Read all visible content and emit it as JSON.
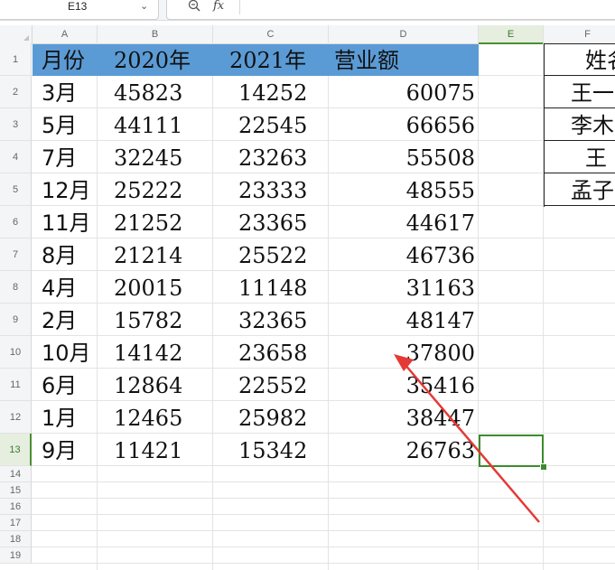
{
  "toolbar": {
    "name_box": "E13",
    "fx_label": "fx",
    "zoom_icon": "zoom-icon",
    "dropdown_icon": "chevron-down-icon"
  },
  "columns": [
    "A",
    "B",
    "C",
    "D",
    "E",
    "F"
  ],
  "active_column": "E",
  "active_row": "13",
  "rows": [
    "1",
    "2",
    "3",
    "4",
    "5",
    "6",
    "7",
    "8",
    "9",
    "10",
    "11",
    "12",
    "13",
    "14",
    "15",
    "16",
    "17",
    "18",
    "19"
  ],
  "header": {
    "a": "月份",
    "b": "2020年",
    "c": "2021年",
    "d": "营业额"
  },
  "data_rows": [
    {
      "a": "3月",
      "b": "45823",
      "c": "14252",
      "d": "60075"
    },
    {
      "a": "5月",
      "b": "44111",
      "c": "22545",
      "d": "66656"
    },
    {
      "a": "7月",
      "b": "32245",
      "c": "23263",
      "d": "55508"
    },
    {
      "a": "12月",
      "b": "25222",
      "c": "23333",
      "d": "48555"
    },
    {
      "a": "11月",
      "b": "21252",
      "c": "23365",
      "d": "44617"
    },
    {
      "a": "8月",
      "b": "21214",
      "c": "25522",
      "d": "46736"
    },
    {
      "a": "4月",
      "b": "20015",
      "c": "11148",
      "d": "31163"
    },
    {
      "a": "2月",
      "b": "15782",
      "c": "32365",
      "d": "48147"
    },
    {
      "a": "10月",
      "b": "14142",
      "c": "23658",
      "d": "37800"
    },
    {
      "a": "6月",
      "b": "12864",
      "c": "22552",
      "d": "35416"
    },
    {
      "a": "1月",
      "b": "12465",
      "c": "25982",
      "d": "38447"
    },
    {
      "a": "9月",
      "b": "11421",
      "c": "15342",
      "d": "26763"
    }
  ],
  "f_column": [
    "姓名",
    "王一",
    "李木",
    "王",
    "孟子"
  ],
  "colors": {
    "header_fill": "#5b9bd5",
    "selection": "#3c8b2c",
    "arrow": "#e53935"
  }
}
